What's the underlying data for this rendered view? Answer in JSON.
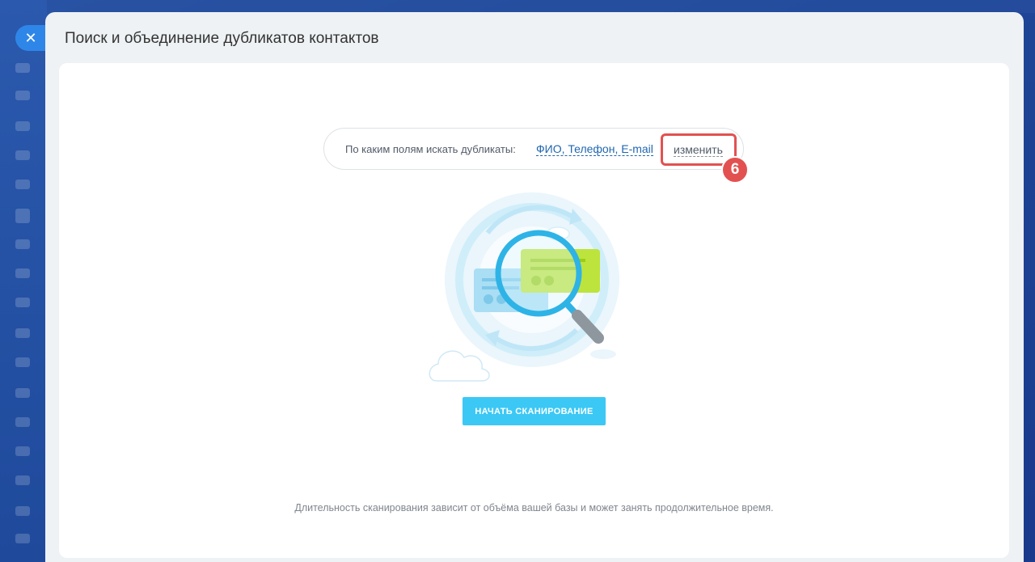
{
  "window": {
    "title": "Поиск и объединение дубликатов контактов",
    "close_icon": "close-icon"
  },
  "fields": {
    "label": "По каким полям искать дубликаты:",
    "value": "ФИО, Телефон, E-mail",
    "change_label": "изменить"
  },
  "annotation": {
    "step_number": "6",
    "color": "#e25150"
  },
  "illustration": {
    "icon": "magnifier-search-duplicates-icon"
  },
  "actions": {
    "scan_label": "НАЧАТЬ СКАНИРОВАНИЕ"
  },
  "footnote": "Длительность сканирования зависит от объёма вашей базы и может занять продолжительное время.",
  "colors": {
    "accent": "#3bc8f5",
    "link": "#2067b0",
    "close_button": "#2e86e8"
  }
}
